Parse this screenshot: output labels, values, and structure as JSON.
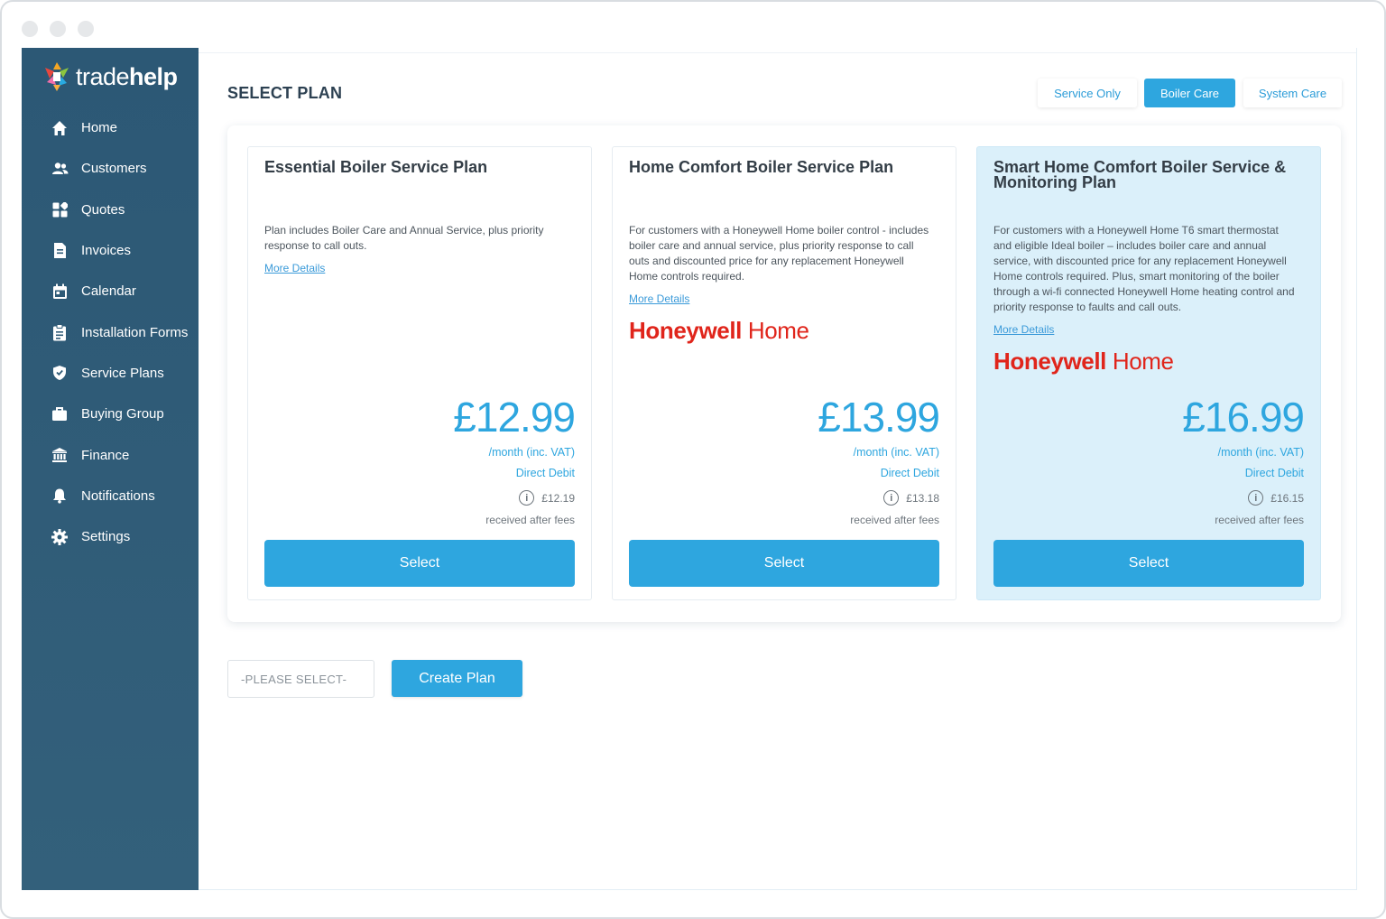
{
  "logo": {
    "part1": "trade",
    "part2": "help"
  },
  "sidebar": {
    "items": [
      {
        "label": "Home",
        "icon": "home-icon"
      },
      {
        "label": "Customers",
        "icon": "users-icon"
      },
      {
        "label": "Quotes",
        "icon": "grid-icon"
      },
      {
        "label": "Invoices",
        "icon": "document-icon"
      },
      {
        "label": "Calendar",
        "icon": "calendar-icon"
      },
      {
        "label": "Installation Forms",
        "icon": "clipboard-icon"
      },
      {
        "label": "Service Plans",
        "icon": "shield-icon"
      },
      {
        "label": "Buying Group",
        "icon": "briefcase-icon"
      },
      {
        "label": "Finance",
        "icon": "bank-icon"
      },
      {
        "label": "Notifications",
        "icon": "bell-icon"
      },
      {
        "label": "Settings",
        "icon": "gear-icon"
      }
    ]
  },
  "page": {
    "title": "SELECT PLAN"
  },
  "plan_types": {
    "options": [
      "Service Only",
      "Boiler Care",
      "System Care"
    ],
    "selected": "Boiler Care"
  },
  "plans": [
    {
      "title": "Essential Boiler Service Plan",
      "description": "Plan includes Boiler Care and Annual Service, plus priority response to call outs.",
      "more_details": "More Details",
      "brand": null,
      "price": "£12.99",
      "per_month": "/month (inc. VAT)",
      "payment": "Direct Debit",
      "net_amount": "£12.19",
      "net_label": "received after fees",
      "select_label": "Select",
      "highlighted": false
    },
    {
      "title": "Home Comfort Boiler Service Plan",
      "description": "For customers with a Honeywell Home boiler control - includes boiler care and annual service, plus priority response to call outs and discounted price for any replacement Honeywell Home controls required.",
      "more_details": "More Details",
      "brand": {
        "bold": "Honeywell",
        "regular": "Home"
      },
      "price": "£13.99",
      "per_month": "/month (inc. VAT)",
      "payment": "Direct Debit",
      "net_amount": "£13.18",
      "net_label": "received after fees",
      "select_label": "Select",
      "highlighted": false
    },
    {
      "title": "Smart Home Comfort Boiler Service & Monitoring Plan",
      "description": "For customers with a Honeywell Home T6 smart thermostat and eligible Ideal boiler – includes boiler care and annual service, with discounted price for any replacement Honeywell Home controls required. Plus, smart monitoring of the boiler through a wi-fi connected Honeywell Home heating control and priority response to faults and call outs.",
      "more_details": "More Details",
      "brand": {
        "bold": "Honeywell",
        "regular": "Home"
      },
      "price": "£16.99",
      "per_month": "/month (inc. VAT)",
      "payment": "Direct Debit",
      "net_amount": "£16.15",
      "net_label": "received after fees",
      "select_label": "Select",
      "highlighted": true
    }
  ],
  "footer": {
    "select_placeholder": "-PLEASE SELECT-",
    "create_label": "Create Plan"
  },
  "colors": {
    "sidebar": "#2f5b77",
    "accent": "#2ea6df",
    "highlight_card": "#dbf0fa",
    "brand_red": "#e0251b"
  }
}
